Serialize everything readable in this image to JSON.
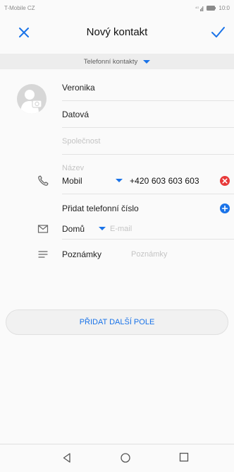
{
  "status_bar": {
    "carrier": "T-Mobile CZ",
    "time": "10:0"
  },
  "header": {
    "title": "Nový kontakt",
    "close_icon": "close-icon",
    "confirm_icon": "check-icon"
  },
  "account": {
    "label": "Telefonní kontakty",
    "icon": "dropdown-triangle-icon"
  },
  "contact": {
    "first_name": "Veronika",
    "last_name": "Datová",
    "company_placeholder": "Společnost",
    "title_placeholder": "Název"
  },
  "phone": {
    "type": "Mobil",
    "number": "+420 603 603 603",
    "add_label": "Přidat telefonní číslo"
  },
  "email": {
    "type": "Domů",
    "placeholder": "E-mail"
  },
  "notes": {
    "label": "Poznámky",
    "placeholder": "Poznámky"
  },
  "more_fields_label": "PŘIDAT DALŠÍ POLE",
  "colors": {
    "accent": "#1a73e8",
    "delete": "#e83a3a",
    "separator": "#e3e3e3",
    "account_bar": "#ededed"
  },
  "nav": {
    "back_icon": "back-triangle-icon",
    "home_icon": "home-circle-icon",
    "recents_icon": "recents-square-icon"
  }
}
